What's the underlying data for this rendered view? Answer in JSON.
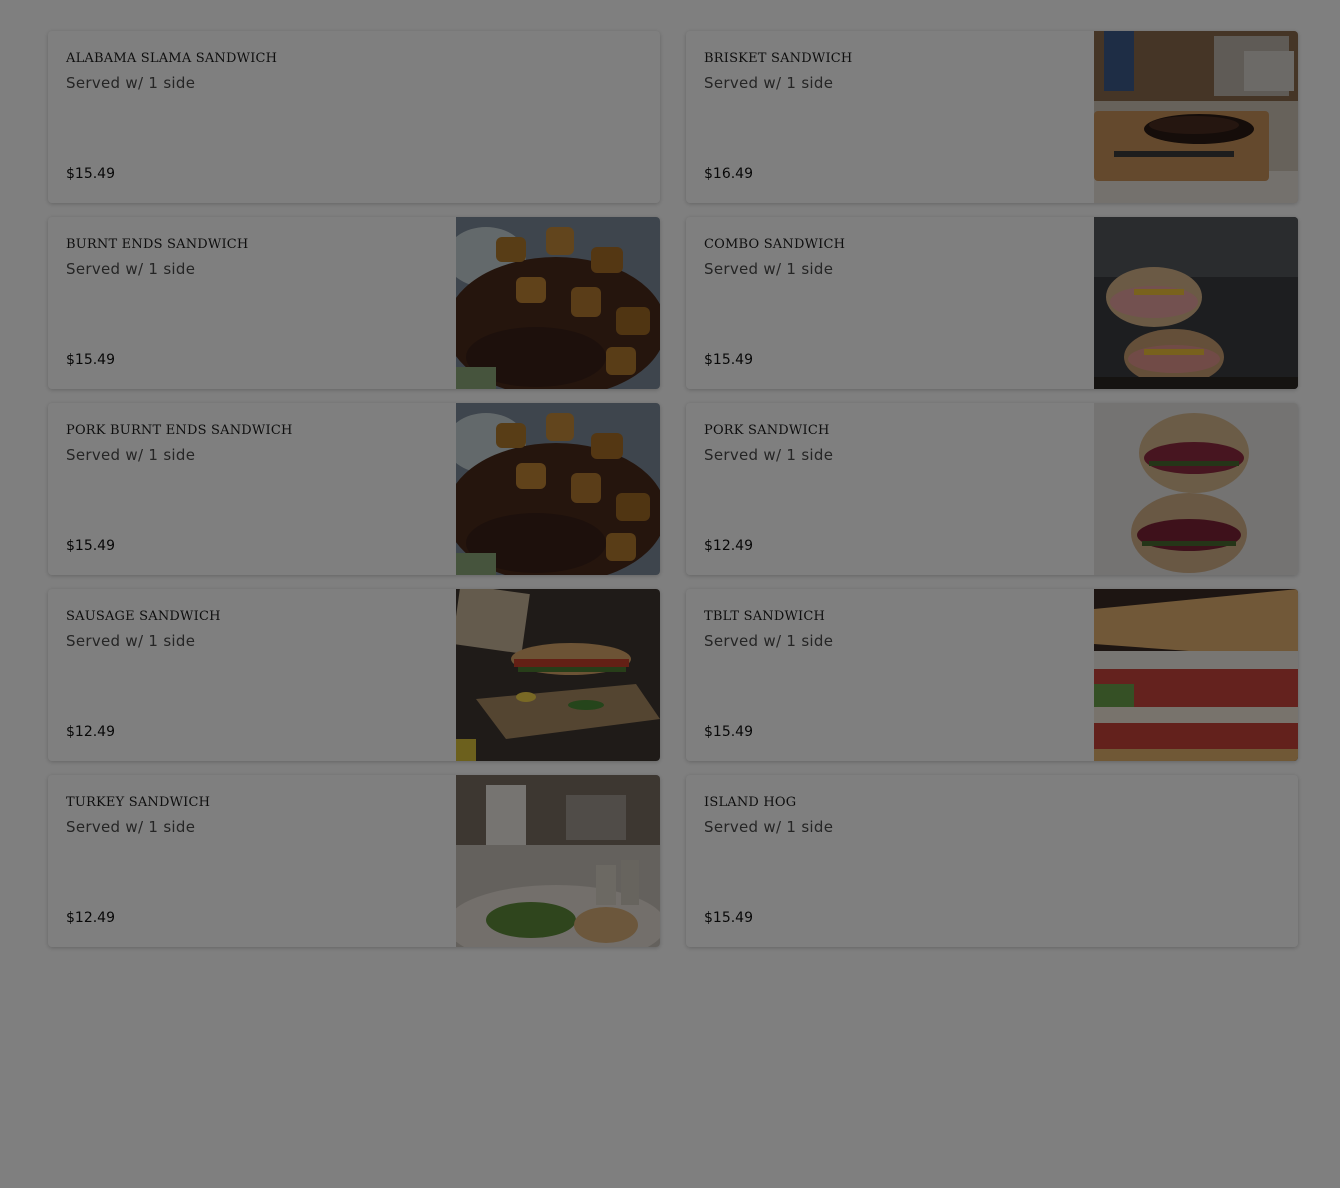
{
  "menu": {
    "items": [
      {
        "name": "ALABAMA SLAMA SANDWICH",
        "description": "Served w/ 1 side",
        "price": "$15.49",
        "image": ""
      },
      {
        "name": "BRISKET SANDWICH",
        "description": "Served w/ 1 side",
        "price": "$16.49",
        "image": "brisket-photo"
      },
      {
        "name": "BURNT ENDS SANDWICH",
        "description": "Served w/ 1 side",
        "price": "$15.49",
        "image": "burnt-ends-photo"
      },
      {
        "name": "COMBO SANDWICH",
        "description": "Served w/ 1 side",
        "price": "$15.49",
        "image": "combo-photo"
      },
      {
        "name": "PORK BURNT ENDS SANDWICH",
        "description": "Served w/ 1 side",
        "price": "$15.49",
        "image": "burnt-ends-photo"
      },
      {
        "name": "PORK SANDWICH",
        "description": "Served w/ 1 side",
        "price": "$12.49",
        "image": "pork-photo"
      },
      {
        "name": "SAUSAGE SANDWICH",
        "description": "Served w/ 1 side",
        "price": "$12.49",
        "image": "sausage-photo"
      },
      {
        "name": "TBLT SANDWICH",
        "description": "Served w/ 1 side",
        "price": "$15.49",
        "image": "tblt-photo"
      },
      {
        "name": "TURKEY SANDWICH",
        "description": "Served w/ 1 side",
        "price": "$12.49",
        "image": "turkey-photo"
      },
      {
        "name": "ISLAND HOG",
        "description": "Served w/ 1 side",
        "price": "$15.49",
        "image": ""
      }
    ]
  },
  "colors": {
    "overlay": "#000000",
    "card_background": "#ffffff",
    "page_background": "#ffffff"
  }
}
